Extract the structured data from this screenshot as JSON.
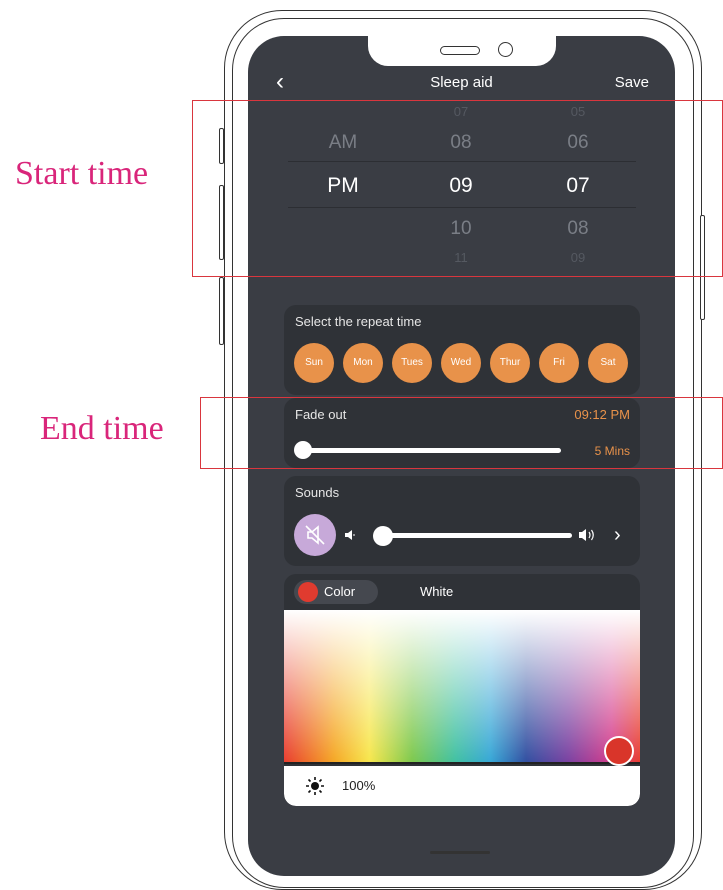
{
  "header": {
    "back_icon": "chevron-left-icon",
    "title": "Sleep aid",
    "save_label": "Save"
  },
  "picker": {
    "period": [
      "AM",
      "PM"
    ],
    "hours": [
      "07",
      "08",
      "09",
      "10",
      "11"
    ],
    "minutes": [
      "05",
      "06",
      "07",
      "08",
      "09"
    ],
    "selected": {
      "period": "PM",
      "hour": "09",
      "minute": "07"
    }
  },
  "repeat": {
    "title": "Select the repeat time",
    "days": [
      "Sun",
      "Mon",
      "Tues",
      "Wed",
      "Thur",
      "Fri",
      "Sat"
    ]
  },
  "fade_out": {
    "title": "Fade out",
    "end_time": "09:12 PM",
    "duration": "5 Mins",
    "level": 0
  },
  "sounds": {
    "title": "Sounds",
    "mute_icon": "mute-icon",
    "volume_level": 0
  },
  "light": {
    "tab_color": "Color",
    "tab_white": "White",
    "selected_color": "#e03b2f",
    "brightness": "100%",
    "brightness_icon": "sun-icon"
  },
  "annotations": {
    "start_time": "Start time",
    "end_time": "End time"
  },
  "colors": {
    "accent_orange": "#e8924a",
    "annotation_red": "#d9363e",
    "annotation_magenta": "#d9257a",
    "screen_bg": "#3a3d44"
  }
}
